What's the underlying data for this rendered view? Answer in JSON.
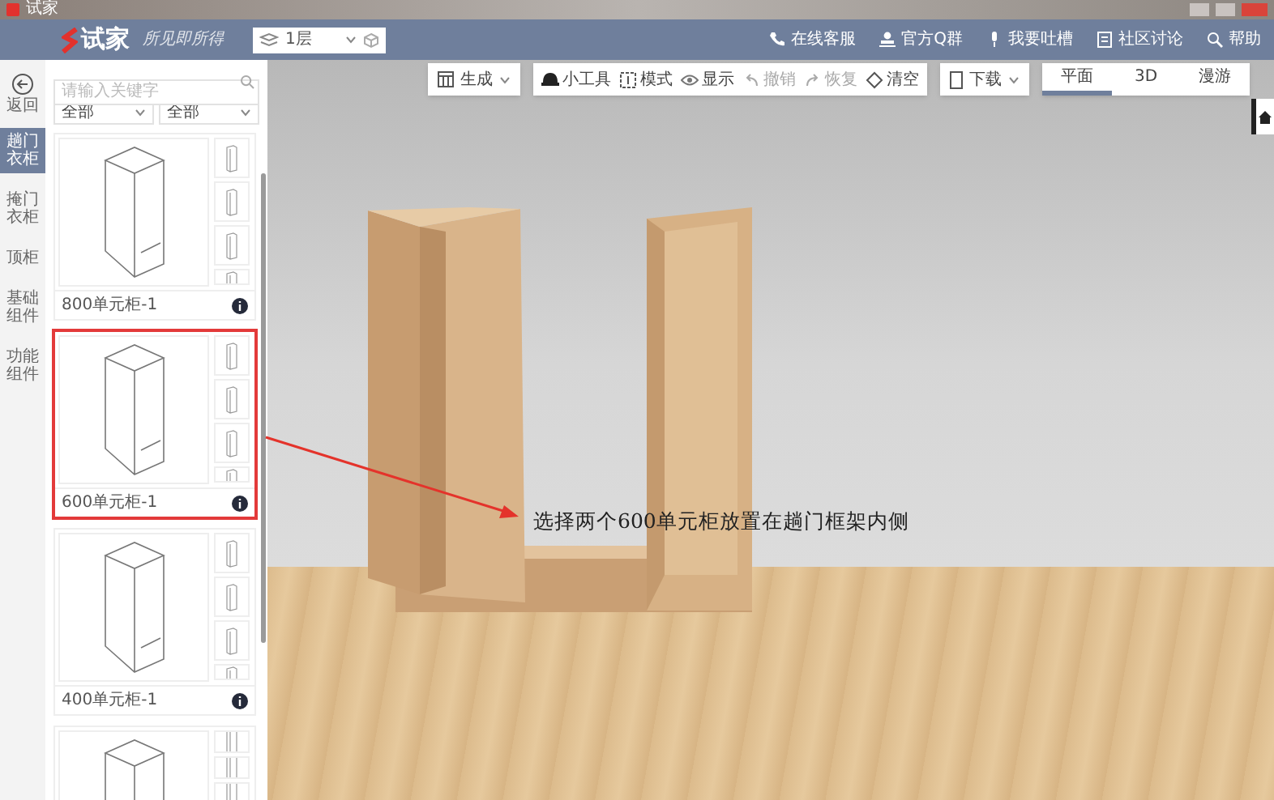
{
  "window": {
    "title": "试家"
  },
  "header": {
    "logo": "试家",
    "slogan": "所见即所得",
    "floor_select": {
      "value": "1层"
    },
    "links": [
      {
        "label": "在线客服"
      },
      {
        "label": "官方Q群"
      },
      {
        "label": "我要吐槽"
      },
      {
        "label": "社区讨论"
      },
      {
        "label": "帮助"
      }
    ]
  },
  "nav": {
    "back": "返回",
    "items": [
      {
        "label": "趟门衣柜",
        "selected": true
      },
      {
        "label": "掩门衣柜",
        "selected": false
      },
      {
        "label": "顶柜",
        "selected": false
      },
      {
        "label": "基础组件",
        "selected": false
      },
      {
        "label": "功能组件",
        "selected": false
      }
    ]
  },
  "panel": {
    "search": {
      "placeholder": "请输入关键字"
    },
    "filters": [
      {
        "value": "全部"
      },
      {
        "value": "全部"
      }
    ],
    "cards": [
      {
        "label": "800单元柜-1",
        "selected": false
      },
      {
        "label": "600单元柜-1",
        "selected": true
      },
      {
        "label": "400单元柜-1",
        "selected": false
      },
      {
        "selected": false
      }
    ]
  },
  "toolbar": {
    "generate": "生成",
    "tools": [
      "小工具",
      "模式",
      "显示",
      "撤销",
      "恢复",
      "清空"
    ],
    "download": "下载"
  },
  "view_tabs": [
    {
      "label": "平面",
      "selected": true
    },
    {
      "label": "3D",
      "selected": false
    },
    {
      "label": "漫游",
      "selected": false
    }
  ],
  "annotation": {
    "text": "选择两个600单元柜放置在趟门框架内侧"
  }
}
